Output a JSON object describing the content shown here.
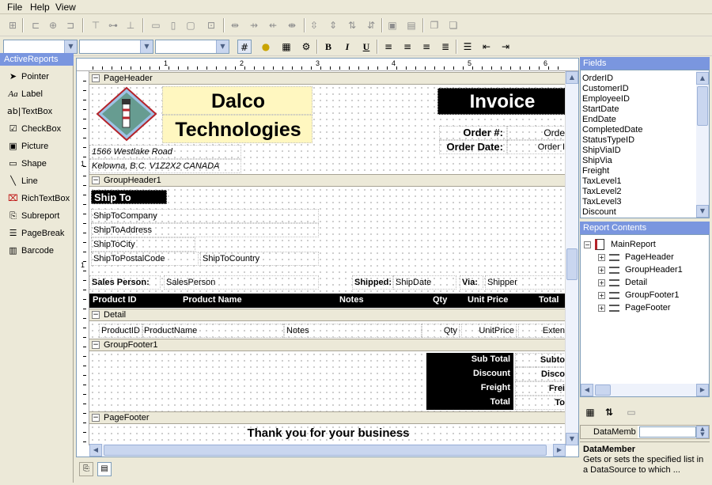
{
  "menu": [
    "File",
    "Help",
    "View"
  ],
  "toolbox": {
    "title": "ActiveReports",
    "items": [
      {
        "label": "Pointer",
        "icon": "pointer-icon"
      },
      {
        "label": "Label",
        "icon": "label-icon"
      },
      {
        "label": "TextBox",
        "icon": "textbox-icon"
      },
      {
        "label": "CheckBox",
        "icon": "checkbox-icon"
      },
      {
        "label": "Picture",
        "icon": "picture-icon"
      },
      {
        "label": "Shape",
        "icon": "shape-icon"
      },
      {
        "label": "Line",
        "icon": "line-icon"
      },
      {
        "label": "RichTextBox",
        "icon": "richtextbox-icon"
      },
      {
        "label": "Subreport",
        "icon": "subreport-icon"
      },
      {
        "label": "PageBreak",
        "icon": "pagebreak-icon"
      },
      {
        "label": "Barcode",
        "icon": "barcode-icon"
      }
    ]
  },
  "ruler": {
    "numbers": [
      "1",
      "2",
      "3",
      "4",
      "5",
      "6"
    ],
    "left_numbers": [
      "1",
      "1"
    ]
  },
  "format_buttons": {
    "bold": "B",
    "italic": "I",
    "underline": "U"
  },
  "designer": {
    "page_header": {
      "band": "PageHeader",
      "company_line1": "Dalco",
      "company_line2": "Technologies",
      "address1": "1566 Westlake Road",
      "address2": "Kelowna, B.C. V1Z2X2 CANADA",
      "invoice_title": "Invoice",
      "order_no_label": "Order #:",
      "order_no_value": "Orde",
      "order_date_label": "Order Date:",
      "order_date_value": "Order I"
    },
    "group_header": {
      "band": "GroupHeader1",
      "ship_to": "Ship To",
      "ship_company": "ShipToCompany",
      "ship_address": "ShipToAddress",
      "ship_city": "ShipToCity",
      "ship_postal": "ShipToPostalCode",
      "ship_country": "ShipToCountry",
      "sales_person_label": "Sales Person:",
      "sales_person_value": "SalesPerson",
      "shipped_label": "Shipped:",
      "shipped_value": "ShipDate",
      "via_label": "Via:",
      "via_value": "Shipper",
      "columns": [
        "Product ID",
        "Product Name",
        "Notes",
        "Qty",
        "Unit Price",
        "Total"
      ]
    },
    "detail": {
      "band": "Detail",
      "product_id": "ProductID",
      "product_name": "ProductName",
      "notes": "Notes",
      "qty": "Qty",
      "unit_price": "UnitPrice",
      "extended": "Exten"
    },
    "group_footer": {
      "band": "GroupFooter1",
      "labels": [
        "Sub Total",
        "Discount",
        "Freight",
        "Total"
      ],
      "values": [
        "Subto",
        "Disco",
        "Frei",
        "To"
      ]
    },
    "page_footer": {
      "band": "PageFooter",
      "thank_you": "Thank you for your business"
    }
  },
  "fields": {
    "title": "Fields",
    "items": [
      "OrderID",
      "CustomerID",
      "EmployeeID",
      "StartDate",
      "EndDate",
      "CompletedDate",
      "StatusTypeID",
      "ShipViaID",
      "ShipVia",
      "Freight",
      "TaxLevel1",
      "TaxLevel2",
      "TaxLevel3",
      "Discount"
    ]
  },
  "report_contents": {
    "title": "Report Contents",
    "root": "MainReport",
    "children": [
      "PageHeader",
      "GroupHeader1",
      "Detail",
      "GroupFooter1",
      "PageFooter"
    ]
  },
  "properties": {
    "row_name": "DataMemb",
    "desc_title": "DataMember",
    "desc_text": "Gets or sets the specified list in a DataSource to which ..."
  },
  "colors": {
    "accent": "#7a96df",
    "invoice_bg": "#000000",
    "company_bg": "#fff7c0"
  }
}
